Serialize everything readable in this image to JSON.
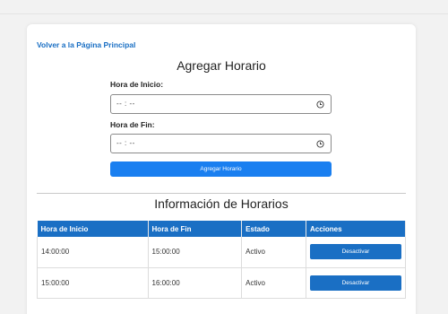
{
  "nav": {
    "back_label": "Volver a la Página Principal"
  },
  "form": {
    "title": "Agregar Horario",
    "start_label": "Hora de Inicio:",
    "start_value": "-- : --",
    "end_label": "Hora de Fin:",
    "end_value": "-- : --",
    "submit_label": "Agregar Horario"
  },
  "table": {
    "title": "Información de Horarios",
    "headers": [
      "Hora de Inicio",
      "Hora de Fin",
      "Estado",
      "Acciones"
    ],
    "rows": [
      {
        "start": "14:00:00",
        "end": "15:00:00",
        "status": "Activo",
        "action": "Desactivar"
      },
      {
        "start": "15:00:00",
        "end": "16:00:00",
        "status": "Activo",
        "action": "Desactivar"
      }
    ]
  },
  "colors": {
    "accent": "#1a6fc4",
    "button": "#1a7ff0",
    "background": "#f2f2f2"
  },
  "icons": {
    "time_input": "clock-icon"
  }
}
